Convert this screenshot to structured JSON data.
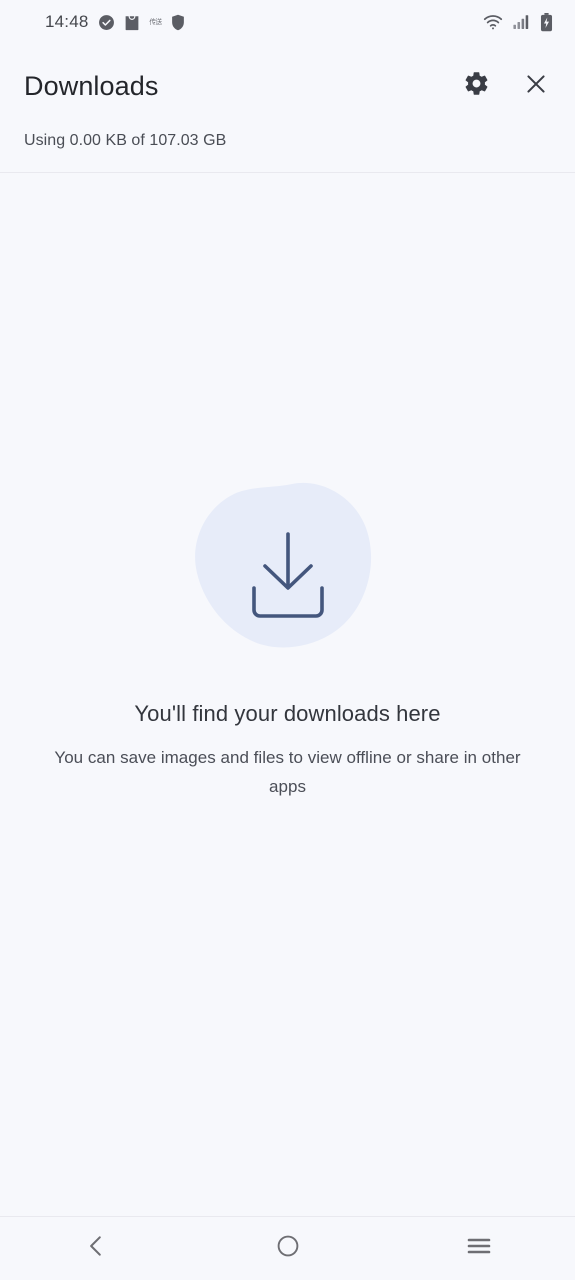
{
  "theme": {
    "background": "#f7f8fc",
    "title_color": "#24262b",
    "body_text_color": "#4b4e57",
    "blob_color": "#e7ecf9",
    "icon_accent": "#44567d",
    "nav_icon_color": "#6e6e73",
    "divider_color": "#e9e9ef"
  },
  "statusbar": {
    "time": "14:48",
    "left_icons": [
      {
        "name": "check-circle-icon"
      },
      {
        "name": "shopping-bag-icon"
      },
      {
        "name": "cjk-text-badge",
        "label": "传送"
      },
      {
        "name": "shield-icon"
      }
    ],
    "right_icons": [
      {
        "name": "wifi-icon"
      },
      {
        "name": "cellular-signal-icon"
      },
      {
        "name": "battery-charging-icon"
      }
    ]
  },
  "header": {
    "title": "Downloads",
    "settings_label": "Settings",
    "close_label": "Close",
    "storage_text": "Using 0.00 KB of 107.03 GB"
  },
  "empty_state": {
    "illustration": "download-tray-icon",
    "headline": "You'll find your downloads here",
    "subtext": "You can save images and files to view offline or share in other apps"
  },
  "navbar": {
    "back_label": "Back",
    "home_label": "Home",
    "recents_label": "Recents"
  }
}
